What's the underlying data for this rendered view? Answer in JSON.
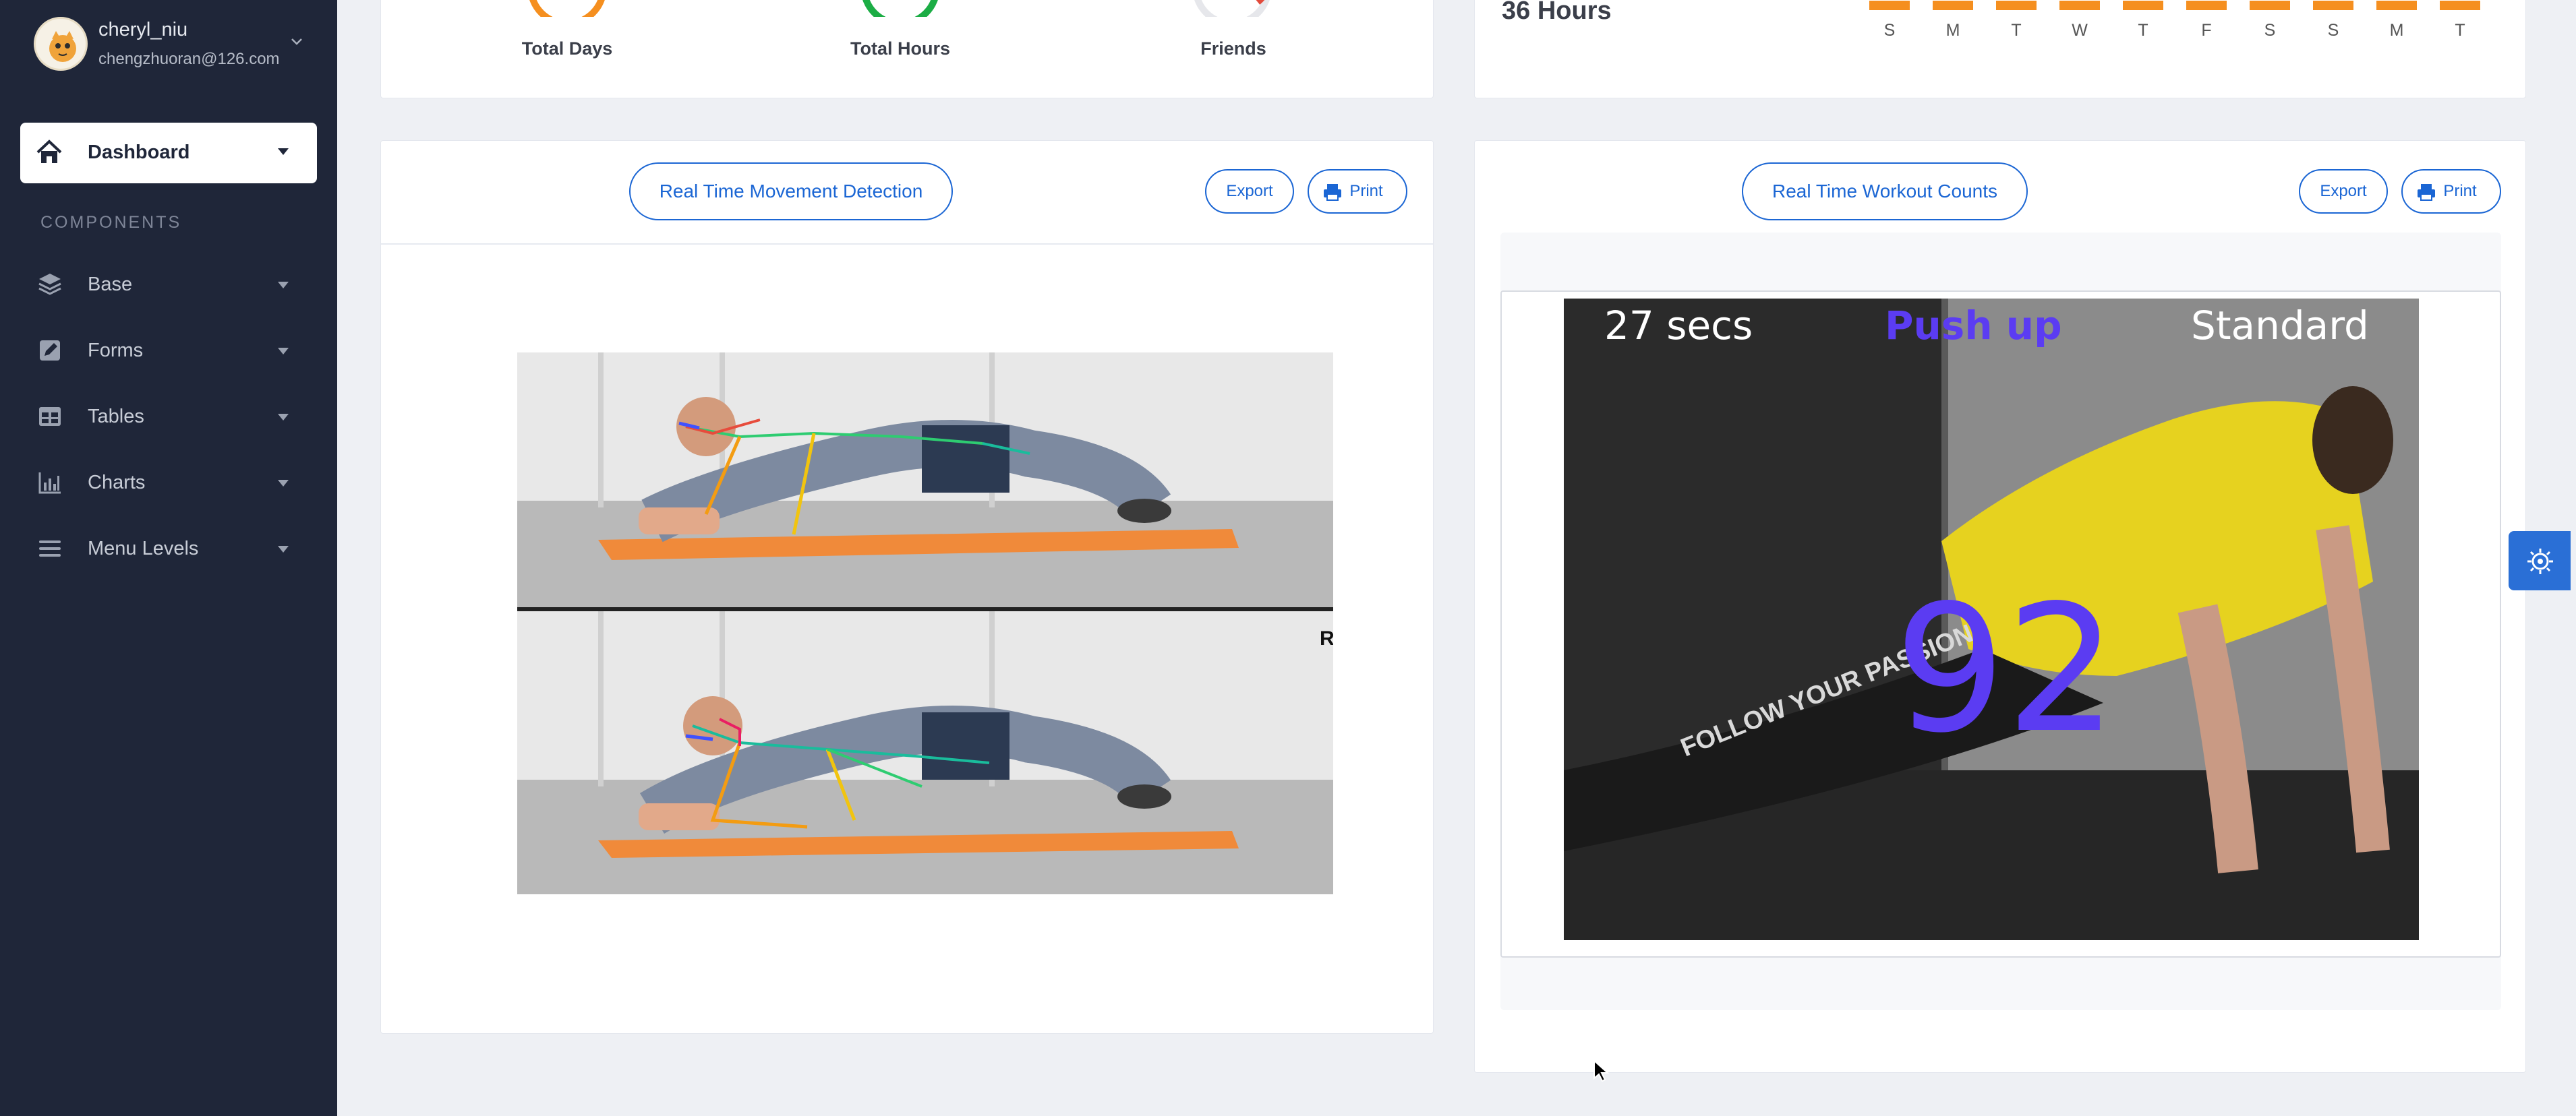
{
  "user": {
    "name": "cheryl_niu",
    "email": "chengzhuoran@126.com"
  },
  "sidebar": {
    "dashboard_label": "Dashboard",
    "section_title": "COMPONENTS",
    "items": [
      {
        "label": "Base",
        "icon": "layers-icon"
      },
      {
        "label": "Forms",
        "icon": "edit-icon"
      },
      {
        "label": "Tables",
        "icon": "table-icon"
      },
      {
        "label": "Charts",
        "icon": "bar-chart-icon"
      },
      {
        "label": "Menu Levels",
        "icon": "menu-icon"
      }
    ]
  },
  "stats": {
    "total_days_label": "Total Days",
    "total_hours_label": "Total Hours",
    "friends_label": "Friends"
  },
  "weekly": {
    "hours": "36 Hours",
    "days": [
      "S",
      "M",
      "T",
      "W",
      "T",
      "F",
      "S",
      "S",
      "M",
      "T"
    ]
  },
  "movement_card": {
    "title": "Real Time Movement Detection",
    "export_label": "Export",
    "print_label": "Print",
    "side_marker": "R"
  },
  "workout_card": {
    "title": "Real Time Workout Counts",
    "export_label": "Export",
    "print_label": "Print",
    "timer": "27 secs",
    "exercise": "Push up",
    "quality": "Standard",
    "count": "92",
    "shirt_text": "FOLLOW YOUR PASSION"
  },
  "colors": {
    "sidebar_bg": "#1f2639",
    "accent": "#1b66d4",
    "orange": "#f58f1f",
    "green": "#1cad45"
  }
}
